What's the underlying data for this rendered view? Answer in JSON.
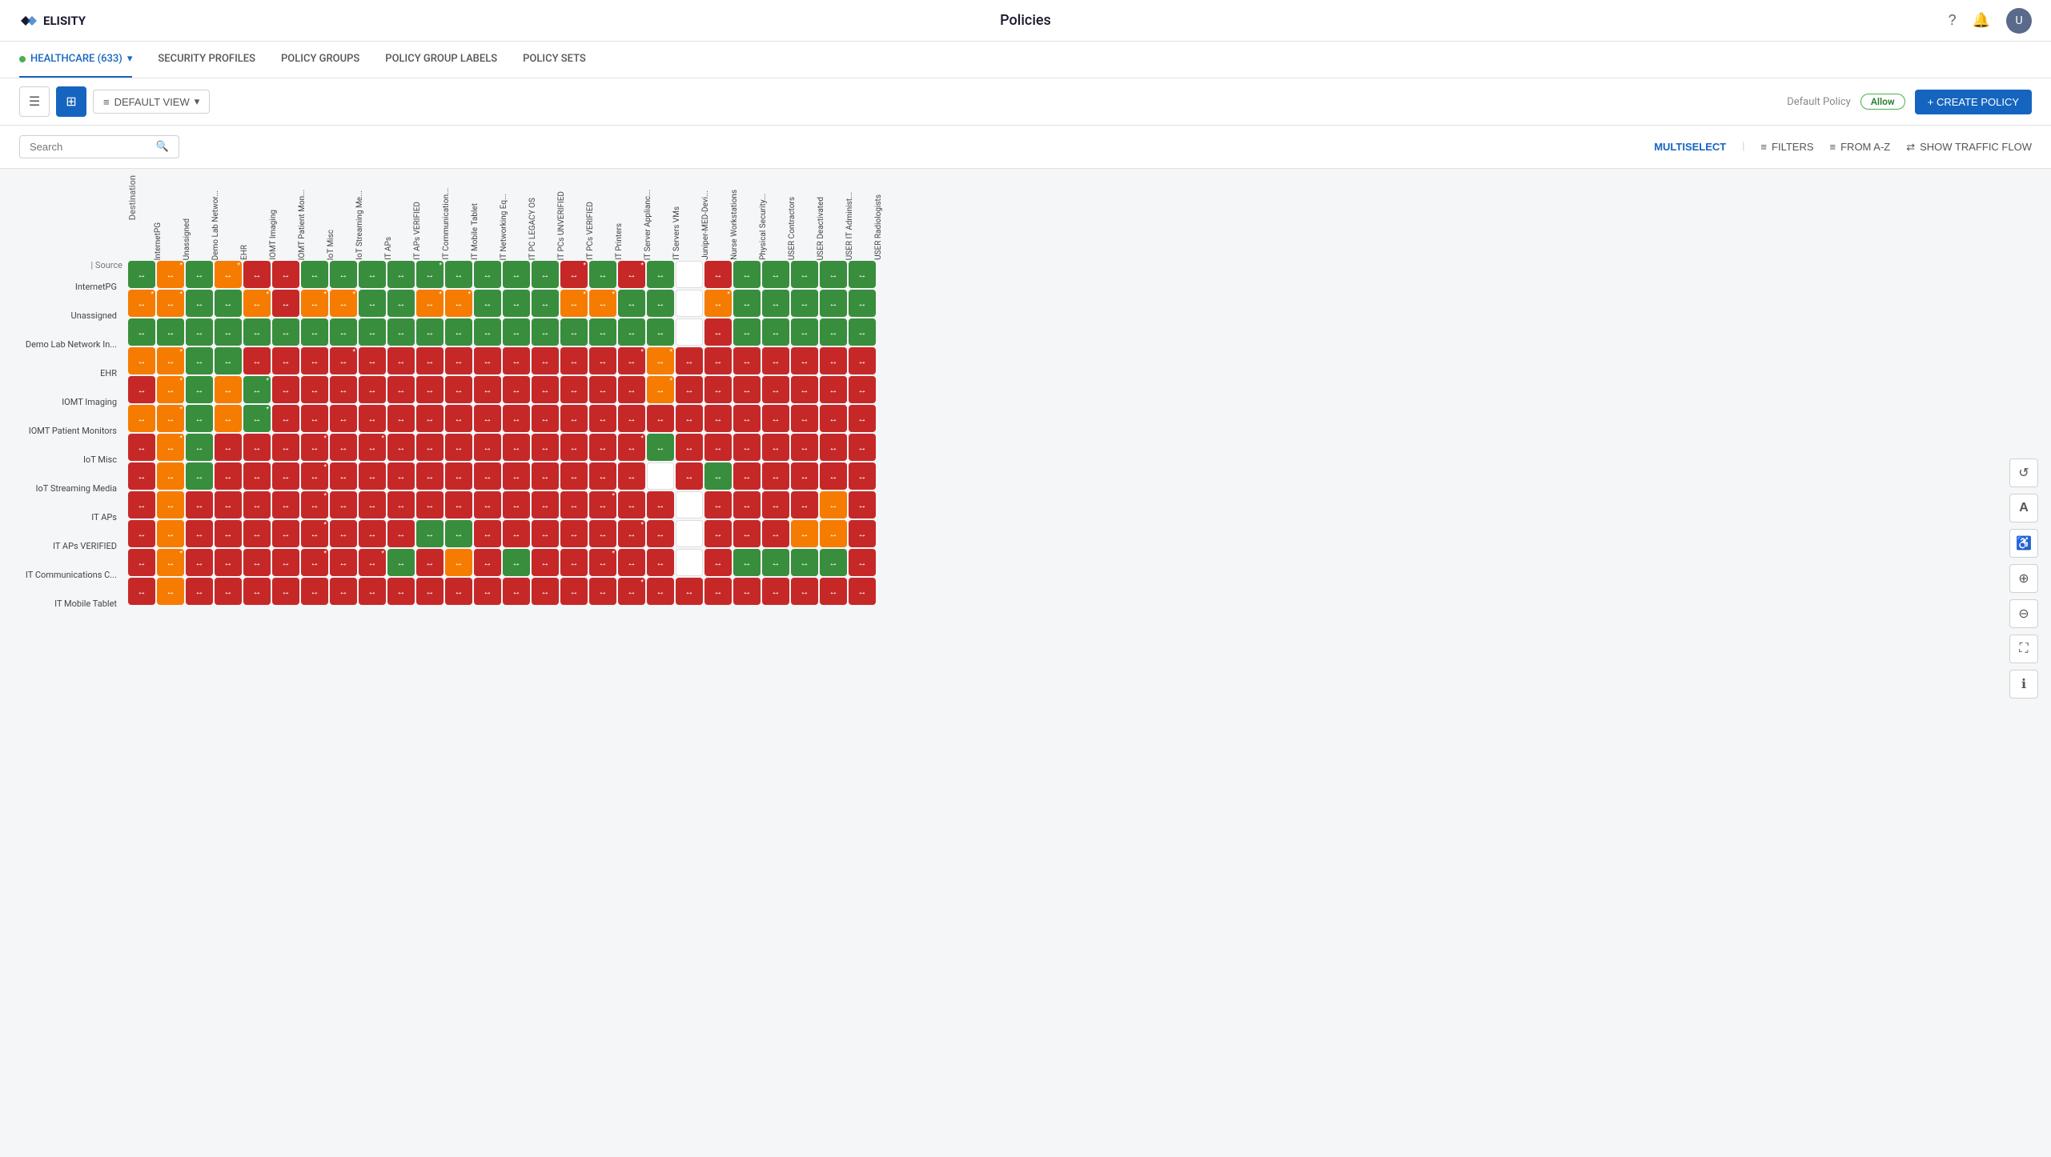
{
  "app": {
    "logo": "ELISITY",
    "title": "Policies"
  },
  "header": {
    "help_icon": "?",
    "bell_icon": "🔔",
    "avatar_initials": "U"
  },
  "nav": {
    "tabs": [
      {
        "id": "healthcare",
        "label": "HEALTHCARE (633)",
        "active": true,
        "has_dot": true,
        "has_chevron": true
      },
      {
        "id": "security-profiles",
        "label": "SECURITY PROFILES",
        "active": false
      },
      {
        "id": "policy-groups",
        "label": "POLICY GROUPS",
        "active": false
      },
      {
        "id": "policy-group-labels",
        "label": "POLICY GROUP LABELS",
        "active": false
      },
      {
        "id": "policy-sets",
        "label": "POLICY SETS",
        "active": false
      }
    ]
  },
  "toolbar": {
    "list_view_label": "☰",
    "grid_view_label": "⊞",
    "default_view_label": "DEFAULT VIEW",
    "default_policy_label": "Default Policy",
    "allow_label": "Allow",
    "create_policy_label": "+ CREATE POLICY"
  },
  "search_bar": {
    "search_placeholder": "Search",
    "multiselect_label": "MULTISELECT",
    "filters_label": "FILTERS",
    "from_az_label": "FROM A-Z",
    "show_traffic_flow_label": "SHOW TRAFFIC FLOW"
  },
  "matrix": {
    "source_label": "Source",
    "destination_label": "Destination",
    "col_headers": [
      "InternetPG",
      "Unassigned",
      "Demo Lab Networ...",
      "EHR",
      "IOMT Imaging",
      "IOMT Patient Mon...",
      "IoT Misc",
      "IoT Streaming Me...",
      "IT APs",
      "IT APs VERIFIED",
      "IT Communication...",
      "IT Mobile Tablet",
      "IT Networking Eq...",
      "IT PC LEGACY OS",
      "IT PCs UNVERIFIED",
      "IT PCs VERIFIED",
      "IT Printers",
      "IT Server Applianc...",
      "IT Servers VMs",
      "Juniper-MED-Devi...",
      "Nurse Workstations",
      "Physical Security...",
      "USER Contractors",
      "USER Deactivated",
      "USER IT Administ...",
      "USER Radiologists"
    ],
    "row_labels": [
      "InternetPG",
      "Unassigned",
      "Demo Lab Network In...",
      "EHR",
      "IOMT Imaging",
      "IOMT Patient Monitors",
      "IoT Misc",
      "IoT Streaming Media",
      "IT APs",
      "IT APs VERIFIED",
      "IT Communications C...",
      "IT Mobile Tablet"
    ],
    "rows": [
      [
        "G",
        "O*",
        "G",
        "O*",
        "R",
        "R",
        "G",
        "G",
        "G",
        "G",
        "G*",
        "G",
        "G",
        "G",
        "G",
        "R*",
        "G",
        "R*",
        "G",
        "W",
        "R",
        "G",
        "G",
        "G",
        "G",
        "G"
      ],
      [
        "O*",
        "O*",
        "G",
        "G",
        "O*",
        "R",
        "O*",
        "O*",
        "G",
        "G",
        "O*",
        "O*",
        "G",
        "G",
        "G",
        "O*",
        "O*",
        "G",
        "G",
        "W",
        "O*",
        "G",
        "G",
        "G",
        "G",
        "G"
      ],
      [
        "G",
        "G",
        "G",
        "G",
        "G",
        "G",
        "G",
        "G",
        "G",
        "G",
        "G",
        "G",
        "G",
        "G",
        "G",
        "G",
        "G",
        "G",
        "G",
        "W",
        "R",
        "G",
        "G",
        "G",
        "G",
        "G"
      ],
      [
        "O",
        "O*",
        "G",
        "G",
        "R",
        "R",
        "R",
        "R*",
        "R",
        "R",
        "R",
        "R",
        "R",
        "R",
        "R",
        "R",
        "R",
        "R*",
        "O*",
        "R",
        "R",
        "R",
        "R",
        "R",
        "R",
        "R"
      ],
      [
        "R",
        "O*",
        "G",
        "O",
        "G*",
        "R",
        "R",
        "R",
        "R",
        "R",
        "R",
        "R",
        "R",
        "R",
        "R",
        "R",
        "R",
        "R",
        "O*",
        "R",
        "R",
        "R",
        "R",
        "R",
        "R",
        "R"
      ],
      [
        "O",
        "O*",
        "G",
        "O",
        "G*",
        "R",
        "R",
        "R",
        "R",
        "R",
        "R",
        "R",
        "R",
        "R",
        "R",
        "R",
        "R",
        "R",
        "R",
        "R",
        "R",
        "R",
        "R",
        "R",
        "R",
        "R"
      ],
      [
        "R",
        "O*",
        "G",
        "R",
        "R",
        "R",
        "R*",
        "R",
        "R*",
        "R",
        "R",
        "R",
        "R",
        "R",
        "R",
        "R",
        "R",
        "R*",
        "G",
        "R",
        "R",
        "R",
        "R",
        "R",
        "R",
        "R"
      ],
      [
        "R",
        "O",
        "G",
        "R",
        "R",
        "R",
        "R*",
        "R",
        "R",
        "R",
        "R",
        "R",
        "R",
        "R",
        "R",
        "R",
        "R",
        "R",
        "W",
        "R",
        "G",
        "R",
        "R",
        "R",
        "R",
        "R"
      ],
      [
        "R",
        "O",
        "R",
        "R",
        "R",
        "R",
        "R*",
        "R",
        "R",
        "R",
        "R",
        "R",
        "R",
        "R",
        "R",
        "R",
        "R*",
        "R",
        "R",
        "W",
        "R",
        "R",
        "R",
        "R",
        "O",
        "R"
      ],
      [
        "R",
        "O",
        "R",
        "R",
        "R",
        "R",
        "R*",
        "R",
        "R",
        "R",
        "G",
        "G",
        "R",
        "R",
        "R",
        "R",
        "R",
        "R*",
        "R",
        "W",
        "R",
        "R",
        "R",
        "O",
        "O",
        "R"
      ],
      [
        "R",
        "O*",
        "R",
        "R",
        "R",
        "R",
        "R*",
        "R",
        "R*",
        "G",
        "R",
        "O",
        "R",
        "G",
        "R",
        "R",
        "R*",
        "R",
        "R",
        "W",
        "R",
        "G",
        "G",
        "G",
        "G",
        "R"
      ],
      [
        "R",
        "O",
        "R",
        "R",
        "R",
        "R",
        "R",
        "R",
        "R",
        "R",
        "R",
        "R",
        "R",
        "R",
        "R",
        "R",
        "R",
        "R*",
        "R",
        "R",
        "R",
        "R",
        "R",
        "R",
        "R",
        "R"
      ]
    ],
    "cell_symbols": {
      "arrow_both": "↔",
      "arrow_right": "→",
      "star": "*"
    }
  },
  "right_controls": [
    {
      "id": "refresh",
      "icon": "↺"
    },
    {
      "id": "text-size",
      "icon": "A"
    },
    {
      "id": "accessibility",
      "icon": "♿"
    },
    {
      "id": "zoom-in",
      "icon": "🔍+"
    },
    {
      "id": "zoom-out",
      "icon": "🔍-"
    },
    {
      "id": "fullscreen",
      "icon": "⛶"
    },
    {
      "id": "info",
      "icon": "ℹ"
    }
  ],
  "colors": {
    "green": "#388e3c",
    "red": "#c62828",
    "orange": "#f57c00",
    "white": "#fff",
    "accent_blue": "#1565c0"
  }
}
